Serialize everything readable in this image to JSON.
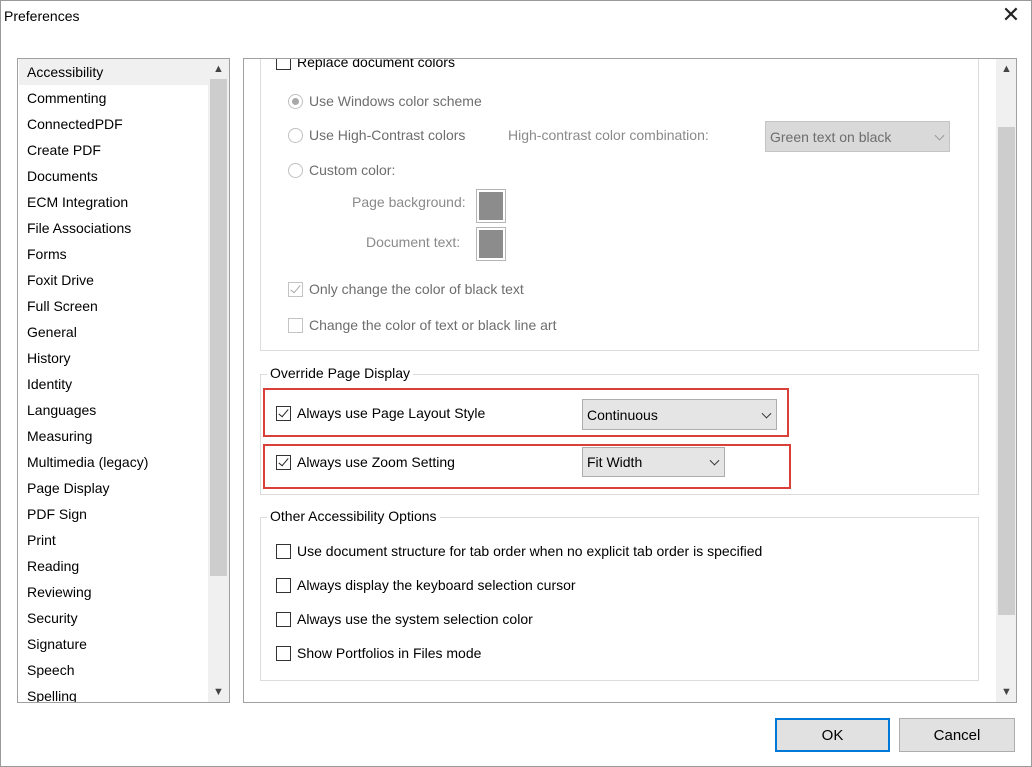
{
  "window": {
    "title": "Preferences",
    "close_glyph": "✕"
  },
  "categories": [
    "Accessibility",
    "Commenting",
    "ConnectedPDF",
    "Create PDF",
    "Documents",
    "ECM Integration",
    "File Associations",
    "Forms",
    "Foxit Drive",
    "Full Screen",
    "General",
    "History",
    "Identity",
    "Languages",
    "Measuring",
    "Multimedia (legacy)",
    "Page Display",
    "PDF Sign",
    "Print",
    "Reading",
    "Reviewing",
    "Security",
    "Signature",
    "Speech",
    "Spelling"
  ],
  "selected_category": "Accessibility",
  "doc_colors": {
    "replace_label": "Replace document colors",
    "replace_checked": false,
    "windows_scheme_label": "Use Windows color scheme",
    "high_contrast_label": "Use High-Contrast colors",
    "high_contrast_combo_label": "High-contrast color combination:",
    "high_contrast_combo_value": "Green text on black",
    "custom_color_label": "Custom color:",
    "page_background_label": "Page background:",
    "document_text_label": "Document text:",
    "only_black_label": "Only change the color of black text",
    "only_black_checked": true,
    "line_art_label": "Change the color of text or black line art",
    "line_art_checked": false
  },
  "override": {
    "legend": "Override Page Display",
    "layout_label": "Always use Page Layout Style",
    "layout_checked": true,
    "layout_value": "Continuous",
    "zoom_label": "Always use Zoom Setting",
    "zoom_checked": true,
    "zoom_value": "Fit Width"
  },
  "other": {
    "legend": "Other Accessibility Options",
    "options": [
      "Use document structure for tab order when no explicit tab order is specified",
      "Always display the keyboard selection cursor",
      "Always use the system selection color",
      "Show Portfolios in Files mode"
    ]
  },
  "buttons": {
    "ok": "OK",
    "cancel": "Cancel"
  },
  "colors": {
    "highlight": "#d9403a",
    "default_button_border": "#0078d7",
    "swatch": "#8c8c8c"
  }
}
